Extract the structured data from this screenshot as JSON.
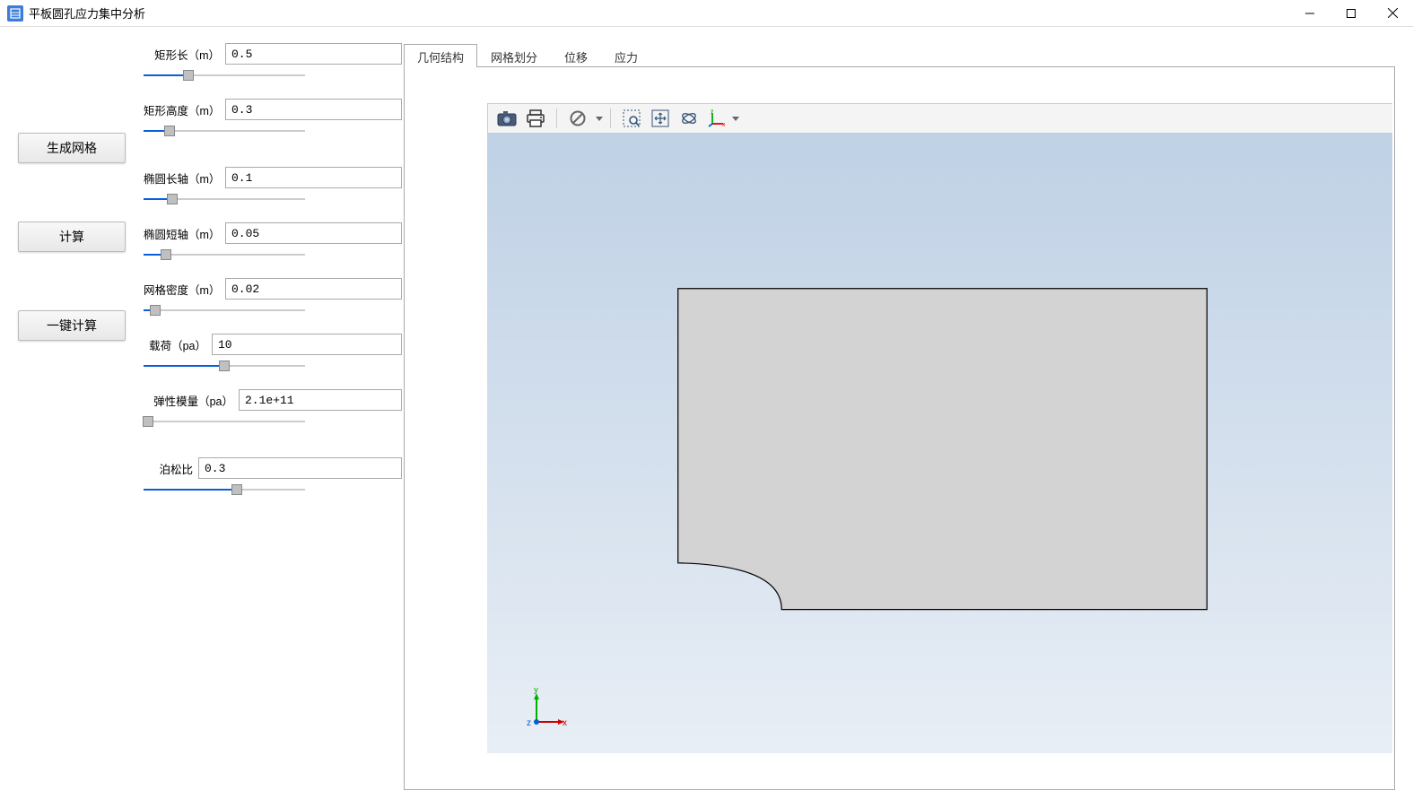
{
  "window": {
    "title": "平板圆孔应力集中分析"
  },
  "buttons": {
    "generate_mesh": "生成网格",
    "calculate": "计算",
    "one_click_calc": "一键计算"
  },
  "params": {
    "rect_length": {
      "label": "矩形长（m）",
      "value": "0.5",
      "slider_pct": 28
    },
    "rect_height": {
      "label": "矩形高度（m）",
      "value": "0.3",
      "slider_pct": 16
    },
    "ellipse_major": {
      "label": "椭圆长轴（m）",
      "value": "0.1",
      "slider_pct": 18
    },
    "ellipse_minor": {
      "label": "椭圆短轴（m）",
      "value": "0.05",
      "slider_pct": 14
    },
    "mesh_density": {
      "label": "网格密度（m）",
      "value": "0.02",
      "slider_pct": 7
    },
    "load": {
      "label": "载荷（pa）",
      "value": "10",
      "slider_pct": 50
    },
    "elastic_modulus": {
      "label": "弹性模量（pa）",
      "value": "2.1e+11",
      "slider_pct": 3
    },
    "poisson_ratio": {
      "label": "泊松比",
      "value": "0.3",
      "slider_pct": 58
    }
  },
  "tabs": {
    "geometry": "几何结构",
    "mesh": "网格划分",
    "displacement": "位移",
    "stress": "应力"
  },
  "toolbar_icons": {
    "camera": "camera-icon",
    "print": "print-icon",
    "disable": "disable-icon",
    "zoom_area": "zoom-area-icon",
    "pan": "pan-icon",
    "rotate": "rotate-icon",
    "axes": "axes-icon"
  },
  "axes_labels": {
    "x": "x",
    "y": "y",
    "z": "z"
  }
}
